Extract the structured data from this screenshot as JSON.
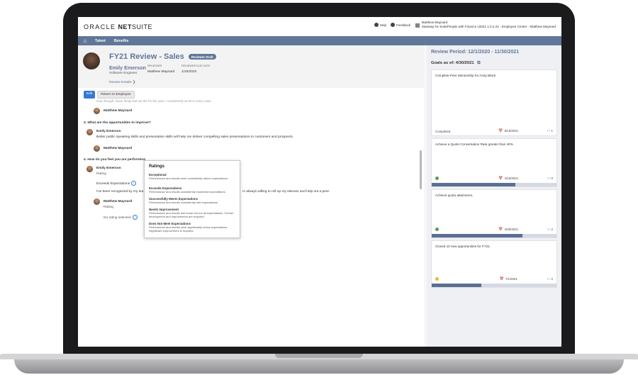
{
  "brand": {
    "oracle": "ORACLE",
    "netsuite_bold": "NET",
    "netsuite_rest": "SUITE"
  },
  "header": {
    "help_label": "Help",
    "feedback_label": "Feedback",
    "user_name": "Matthew Maynard",
    "user_context": "Stairway for SuitePeople with Finance v2021.1.0.4.21 - Employee Center - Matthew Maynard"
  },
  "nav": {
    "tabs": [
      "Talent",
      "Benefits"
    ]
  },
  "record": {
    "title": "FY21 Review - Sales",
    "badge": "Reviewer Draft",
    "employee_name": "Emily Emerson",
    "employee_role": "Software Engineer",
    "reviewer_label": "REVIEWER",
    "reviewer_value": "Matthew Maynard",
    "due_label": "REVIEWER DUE DATE",
    "due_value": "1/15/2022",
    "review_details": "Review Details ❯",
    "edit_button": "Edit",
    "return_button": "Return to Employee"
  },
  "content": {
    "cut_text": "even though I have firmly laid out the for the year, I consistently excel in every case.",
    "reviewer_name": "Matthew Maynard",
    "q3": "3. What are the opportunities to improve?",
    "employee_name": "Emily Emerson",
    "q3_answer": "Better public speaking skills and presentation skills will help me deliver compelling sales presentations to customers and prospects.",
    "q4": "4. How do you feel you are performing",
    "rating_label": "Rating",
    "employee_rating": "Exceeds Expectations",
    "q4_answer_left": "I've been recognized by my tea",
    "q4_answer_right": "m always willing to roll up my sleeves and help out a peer.",
    "reviewer_rating": "No rating selected"
  },
  "tooltip": {
    "title": "Ratings",
    "items": [
      {
        "heading": "Exceptional",
        "desc": "Performance and results were consistently above expectations."
      },
      {
        "heading": "Exceeds Expectations",
        "desc": "Performance and results consistently exceeded expectations."
      },
      {
        "heading": "Successfully Meets Expectations",
        "desc": "Performance and results consistently met expectations."
      },
      {
        "heading": "Needs Improvement",
        "desc": "Performance and results met some but not all expectations. Further development and improvement are required."
      },
      {
        "heading": "Does Not Meet Expectations",
        "desc": "Performance and results were significantly below expectations. Significant improvement is required."
      }
    ]
  },
  "sidepanel": {
    "period": "Review Period: 12/1/2020 - 11/30/2021",
    "goals_asof": "Goals as of: 4/30/2021",
    "goals": [
      {
        "title": "Complete Peer Mentorship for Andy Black",
        "status": "Completed",
        "date": "8/15/2021",
        "comments": "1",
        "progress": 0,
        "dot_color": ""
      },
      {
        "title": "Achieve a Quote Conversation Rate greater than 40%",
        "status": "",
        "date": "4/15/2021",
        "comments": "0",
        "progress": 0.67,
        "dot_color": "#5a9e4b"
      },
      {
        "title": "Achieve quota attainment.",
        "status": "",
        "date": "4/30/2021",
        "comments": "2",
        "progress": 0.73,
        "dot_color": "#5a9e4b"
      },
      {
        "title": "Closed 10 new opportunities for FY21.",
        "status": "",
        "date": "7/1/2021",
        "comments": "2",
        "progress": 0.4,
        "dot_color": "#e8b92f"
      }
    ]
  }
}
